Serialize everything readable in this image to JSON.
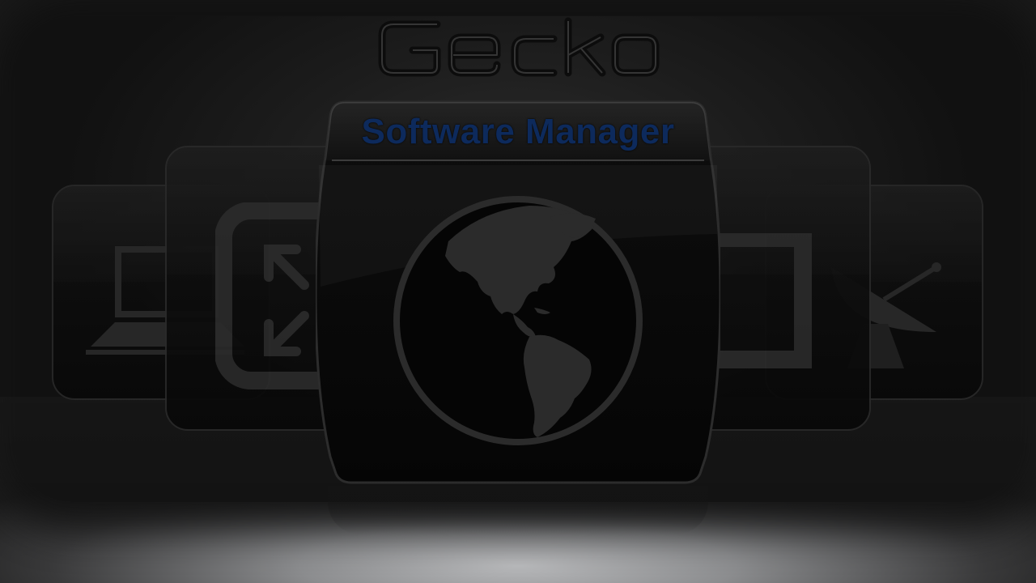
{
  "app": {
    "logo_text": "Gecko",
    "logo_icon": "gecko-logo-icon"
  },
  "carousel": {
    "selected_title": "Software Manager",
    "selected_icon": "globe-icon",
    "items": [
      {
        "icon": "laptop-icon"
      },
      {
        "icon": "resize-arrows-icon"
      },
      {
        "icon": "globe-icon"
      },
      {
        "icon": "screen-frame-icon"
      },
      {
        "icon": "satellite-dish-icon"
      }
    ]
  },
  "colors": {
    "title": "#0d2a5c",
    "card": "#0a0a0a",
    "icon": "#2b2b2b"
  }
}
